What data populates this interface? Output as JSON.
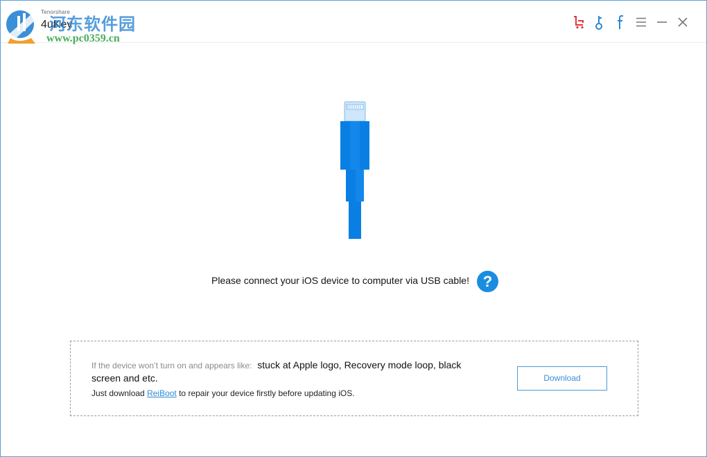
{
  "app": {
    "brand_small": "Tenorshare",
    "title": "4uKey"
  },
  "watermark": {
    "chinese": "河东软件园",
    "url": "www.pc0359.cn"
  },
  "toolbar": {
    "icons": [
      "cart-icon",
      "key-icon",
      "facebook-icon",
      "menu-icon",
      "minimize-icon",
      "close-icon"
    ]
  },
  "main": {
    "connect_message": "Please connect your iOS device to computer via USB cable!",
    "help_symbol": "?"
  },
  "tip": {
    "lead": "If the device won’t turn on and appears like:",
    "symptoms": "stuck at Apple logo, Recovery mode loop, black screen and etc.",
    "line2_prefix": "Just download ",
    "link_text": "ReiBoot",
    "line2_suffix": " to repair your device firstly before updating iOS.",
    "download_label": "Download"
  },
  "colors": {
    "accent": "#1a8de0",
    "cable_blue": "#0a7fe3",
    "cart_red": "#e0353a",
    "window_border": "#5aa0d8"
  }
}
